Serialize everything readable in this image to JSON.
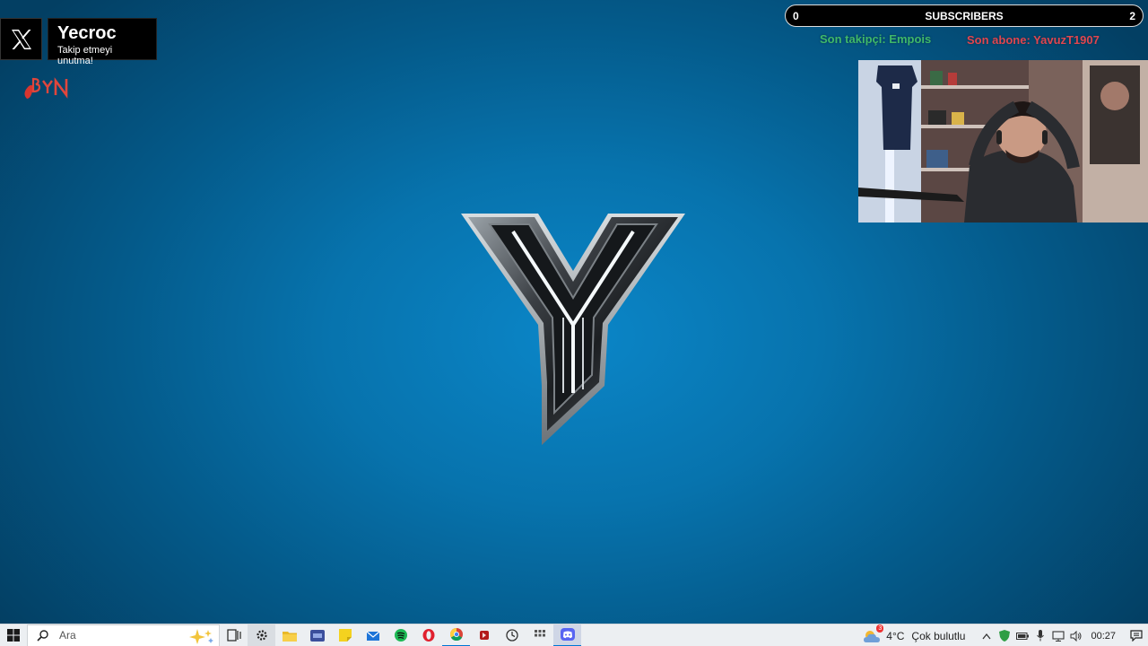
{
  "overlay": {
    "x_card": {
      "name": "Yecroc",
      "subtitle": "Takip etmeyi unutma!",
      "icon": "x-logo-icon"
    },
    "subscribers": {
      "label": "SUBSCRIBERS",
      "current": "0",
      "goal": "2"
    },
    "last_follower": "Son takipçi: Empois",
    "last_subscriber": "Son abone: YavuzT1907",
    "colors": {
      "follower": "#3fb86a",
      "subscriber": "#e0464f"
    }
  },
  "desktop": {
    "background": "#0773ad",
    "logo": "metal-y-logo"
  },
  "taskbar": {
    "search_placeholder": "Ara",
    "apps": [
      "settings-icon",
      "file-explorer-icon",
      "app-icon",
      "sticky-notes-icon",
      "mail-icon",
      "spotify-icon",
      "opera-icon",
      "chrome-icon",
      "app-red-icon",
      "clock-app-icon",
      "calculator-icon",
      "discord-icon"
    ],
    "weather": {
      "temp": "4°C",
      "condition": "Çok bulutlu",
      "badge": "3"
    },
    "clock": "00:27"
  }
}
